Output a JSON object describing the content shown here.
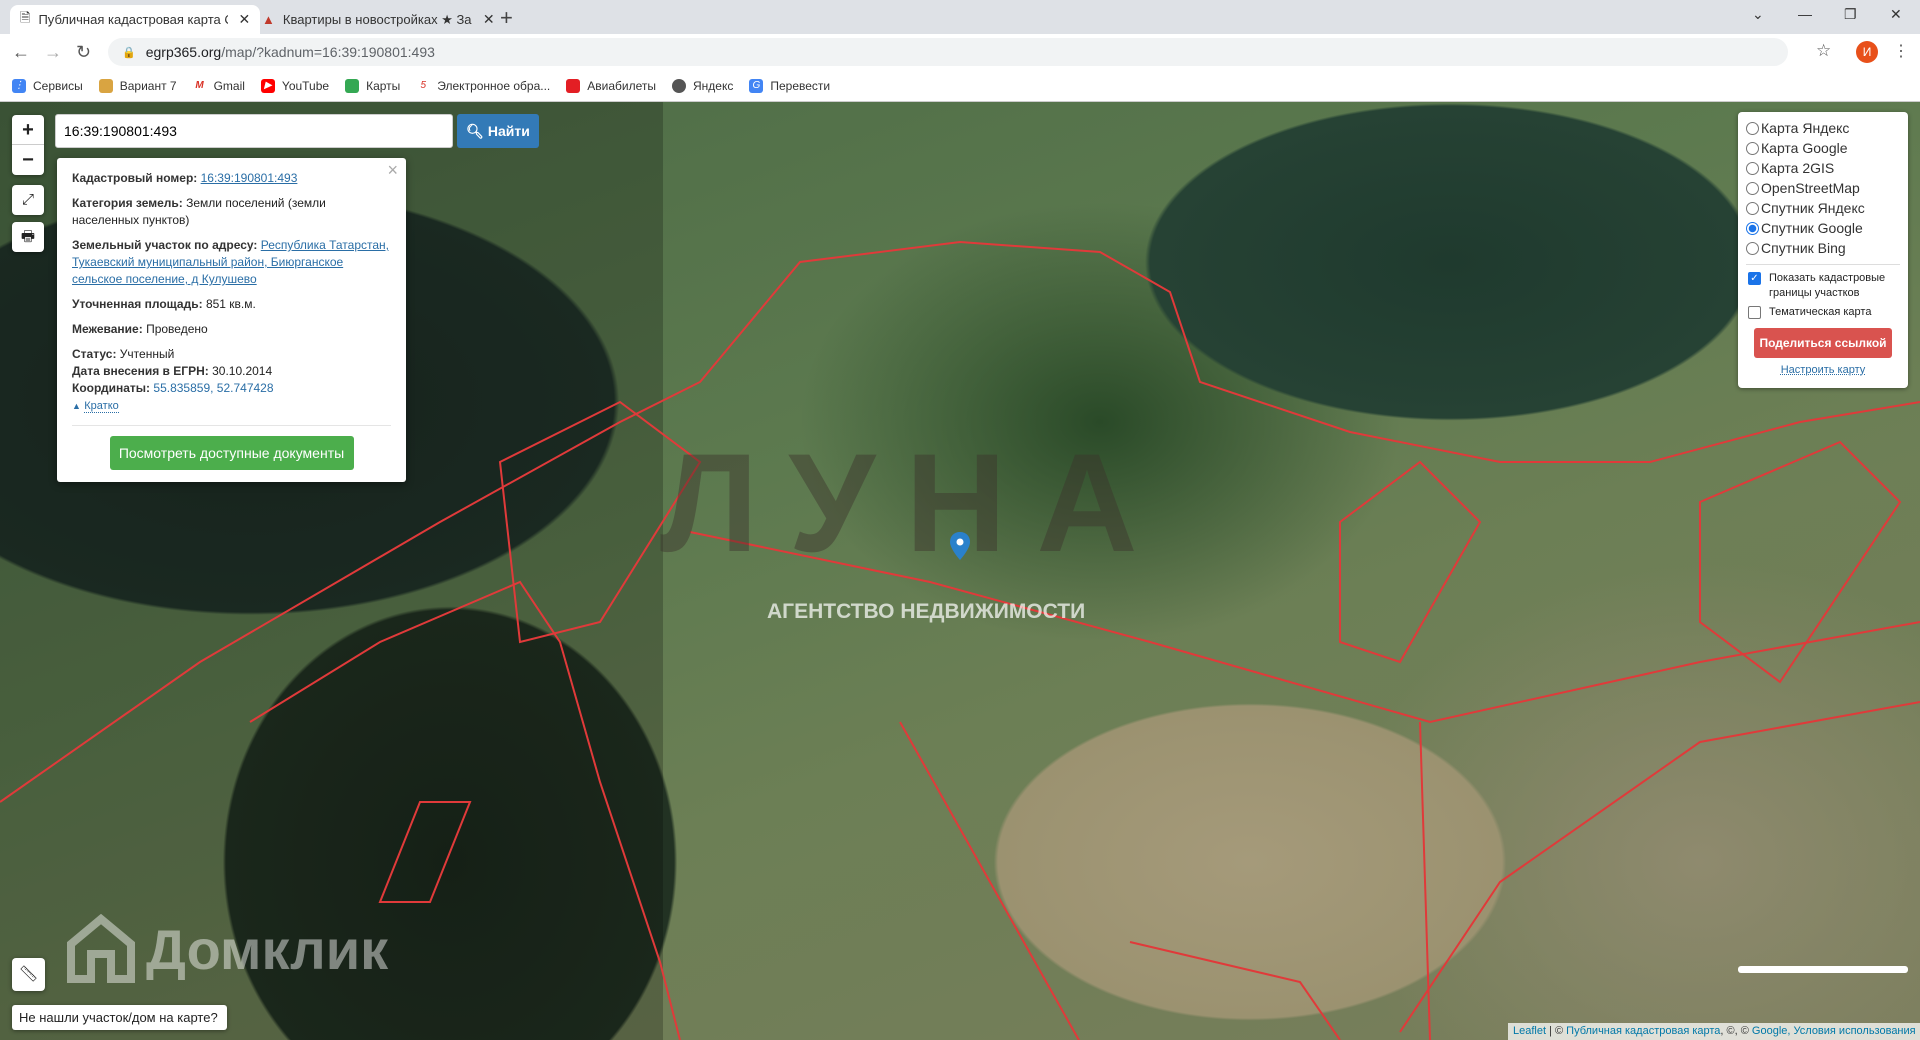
{
  "browser": {
    "tabs": [
      {
        "title": "Публичная кадастровая карта С",
        "active": true
      },
      {
        "title": "Квартиры в новостройках ★ За",
        "active": false
      }
    ],
    "url_domain": "egrp365.org",
    "url_path": "/map/?kadnum=16:39:190801:493",
    "profile_initial": "И",
    "bookmarks": [
      "Сервисы",
      "Вариант 7",
      "Gmail",
      "YouTube",
      "Карты",
      "Электронное обра...",
      "Авиабилеты",
      "Яндекс",
      "Перевести"
    ]
  },
  "map": {
    "search_value": "16:39:190801:493",
    "search_button": "Найти",
    "popup": {
      "cad_label": "Кадастровый номер:",
      "cad_value": "16:39:190801:493",
      "cat_label": "Категория земель:",
      "cat_value": "Земли поселений (земли населенных пунктов)",
      "addr_label": "Земельный участок по адресу:",
      "addr_value": "Республика Татарстан, Тукаевский муниципальный район, Биюрганское сельское поселение, д Кулушево",
      "area_label": "Уточненная площадь:",
      "area_value": "851 кв.м.",
      "survey_label": "Межевание:",
      "survey_value": "Проведено",
      "status_label": "Статус:",
      "status_value": "Учтенный",
      "date_label": "Дата внесения в ЕГРН:",
      "date_value": "30.10.2014",
      "coord_label": "Координаты:",
      "coord_value": "55.835859, 52.747428",
      "brief": "Кратко",
      "docs_button": "Посмотреть доступные документы"
    },
    "layers": [
      {
        "label": "Карта Яндекс",
        "selected": false
      },
      {
        "label": "Карта Google",
        "selected": false
      },
      {
        "label": "Карта 2GIS",
        "selected": false
      },
      {
        "label": "OpenStreetMap",
        "selected": false
      },
      {
        "label": "Спутник Яндекс",
        "selected": false
      },
      {
        "label": "Спутник Google",
        "selected": true
      },
      {
        "label": "Спутник Bing",
        "selected": false
      }
    ],
    "show_bounds": {
      "label": "Показать кадастровые границы участков",
      "checked": true
    },
    "thematic": {
      "label": "Тематическая карта",
      "checked": false
    },
    "share_button": "Поделиться ссылкой",
    "setup_link": "Настроить карту",
    "watermark_agency": "АГЕНТСТВО НЕДВИЖИМОСТИ",
    "watermark_logo": "ЛУНА",
    "watermark_domclick": "Домклик",
    "not_found": "Не нашли участок/дом на карте?",
    "attribution": {
      "leaflet": "Leaflet",
      "sep": " | © ",
      "pkk": "Публичная кадастровая карта",
      "mid": ", ©, © ",
      "google": "Google",
      "terms": ", Условия использования"
    }
  }
}
